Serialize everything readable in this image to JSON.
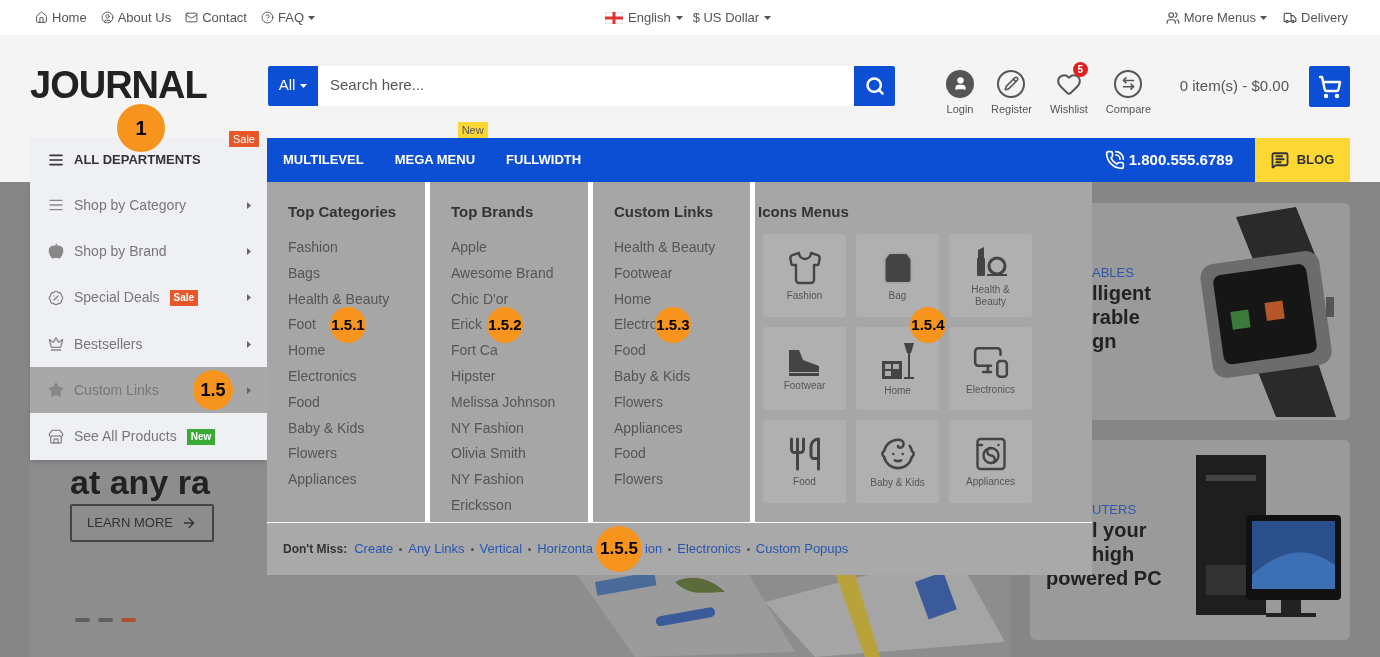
{
  "top_bar": {
    "left_links": [
      {
        "label": "Home",
        "dropdown": false
      },
      {
        "label": "About Us",
        "dropdown": false
      },
      {
        "label": "Contact",
        "dropdown": false
      },
      {
        "label": "FAQ",
        "dropdown": true
      }
    ],
    "language": "English",
    "currency": "$ US Dollar",
    "right_links": [
      {
        "label": "More Menus",
        "dropdown": true
      },
      {
        "label": "Delivery",
        "dropdown": false
      }
    ]
  },
  "header": {
    "logo": "JOURNAL",
    "search": {
      "category": "All",
      "placeholder": "Search here..."
    },
    "account_links": [
      {
        "label": "Login"
      },
      {
        "label": "Register"
      },
      {
        "label": "Wishlist",
        "badge": "5"
      },
      {
        "label": "Compare"
      }
    ],
    "cart": "0 item(s) - $0.00"
  },
  "nav": {
    "departments": {
      "title": "ALL DEPARTMENTS",
      "badge": "Sale",
      "expanded": true,
      "items": [
        {
          "label": "Shop by Category",
          "selected": false,
          "submenu": true
        },
        {
          "label": "Shop by Brand",
          "selected": false,
          "submenu": true
        },
        {
          "label": "Special Deals",
          "selected": false,
          "submenu": true,
          "badge": {
            "text": "Sale",
            "color": "#e8572a"
          }
        },
        {
          "label": "Bestsellers",
          "selected": false,
          "submenu": true
        },
        {
          "label": "Custom Links",
          "selected": true,
          "submenu": true
        },
        {
          "label": "See All Products",
          "selected": false,
          "submenu": false,
          "badge": {
            "text": "New",
            "color": "#3aaa35"
          }
        }
      ]
    },
    "items": [
      {
        "label": "MULTILEVEL"
      },
      {
        "label": "MEGA MENU",
        "badge": "New"
      },
      {
        "label": "FULLWIDTH"
      }
    ],
    "phone": "1.800.555.6789",
    "blog": "BLOG"
  },
  "mega_menu": {
    "columns": [
      {
        "title": "Top Categories",
        "items": [
          "Fashion",
          "Bags",
          "Health & Beauty",
          "Foot",
          "Home",
          "Electronics",
          "Food",
          "Baby & Kids",
          "Flowers",
          "Appliances"
        ]
      },
      {
        "title": "Top Brands",
        "items": [
          "Apple",
          "Awesome Brand",
          "Chic D'or",
          "Erick",
          "Fort Ca",
          "Hipster",
          "Melissa Johnson",
          "NY Fashion",
          "Olivia Smith",
          "NY Fashion",
          "Ericksson"
        ]
      },
      {
        "title": "Custom Links",
        "items": [
          "Health & Beauty",
          "Footwear",
          "Home",
          "Electro",
          "Food",
          "Baby & Kids",
          "Flowers",
          "Appliances",
          "Food",
          "Flowers"
        ]
      }
    ],
    "icons_menu": {
      "title": "Icons Menus",
      "items": [
        "Fashion",
        "Bag",
        "Health & Beauty",
        "Footwear",
        "Home",
        "Electronics",
        "Food",
        "Baby & Kids",
        "Appliances"
      ]
    },
    "dont_miss": {
      "label": "Don't Miss:",
      "links": [
        {
          "text": "Create",
          "separator": false
        },
        {
          "text": "Any Links",
          "separator": true
        },
        {
          "text": "Vertical",
          "separator": true
        },
        {
          "text": "Horizonta",
          "separator": true
        },
        {
          "text": "ion",
          "separator": false
        },
        {
          "text": "Electronics",
          "separator": true
        },
        {
          "text": "Custom Popups",
          "separator": true
        }
      ]
    }
  },
  "hero": {
    "heading": "at any ra",
    "button": "LEARN MORE",
    "slides": [
      {
        "selected": false
      },
      {
        "selected": false
      },
      {
        "selected": true
      }
    ]
  },
  "promo_cards": [
    {
      "eyebrow": "ABLES",
      "lines": [
        {
          "text": "lligent",
          "covered": true
        },
        {
          "text": "rable",
          "covered": true
        },
        {
          "text": "gn",
          "covered": true
        }
      ]
    },
    {
      "eyebrow": "UTERS",
      "lines": [
        {
          "text": "l your",
          "covered": true
        },
        {
          "text": "high",
          "covered": true
        },
        {
          "text": "powered PC",
          "covered": false
        }
      ]
    }
  ],
  "annotations": [
    {
      "label": "1"
    },
    {
      "label": "1.5"
    },
    {
      "label": "1.5.1"
    },
    {
      "label": "1.5.2"
    },
    {
      "label": "1.5.3"
    },
    {
      "label": "1.5.4"
    },
    {
      "label": "1.5.5"
    }
  ]
}
